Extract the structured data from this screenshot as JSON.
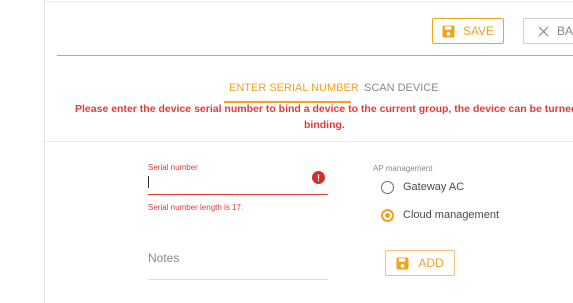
{
  "toolbar": {
    "save_label": "SAVE",
    "back_label": "BA"
  },
  "tabs": [
    {
      "label": "ENTER SERIAL NUMBER",
      "active": true
    },
    {
      "label": "SCAN DEVICE",
      "active": false
    }
  ],
  "warning": {
    "line1": "Please enter the device serial number to bind a device to the current group, the device can be turned off whe",
    "line2": "binding."
  },
  "serial_field": {
    "label": "Serial number",
    "value": "",
    "error": "Serial number length is 17."
  },
  "notes_field": {
    "label": "Notes"
  },
  "ap_management": {
    "label": "AP management",
    "options": [
      {
        "label": "Gateway AC",
        "selected": false
      },
      {
        "label": "Cloud management",
        "selected": true
      }
    ]
  },
  "add_label": "ADD",
  "colors": {
    "accent": "#f3a21d",
    "error": "#e53935"
  },
  "icons": {
    "save": "floppy-disk-icon",
    "back": "close-icon",
    "error": "exclamation-circle-icon",
    "add": "floppy-disk-icon"
  }
}
